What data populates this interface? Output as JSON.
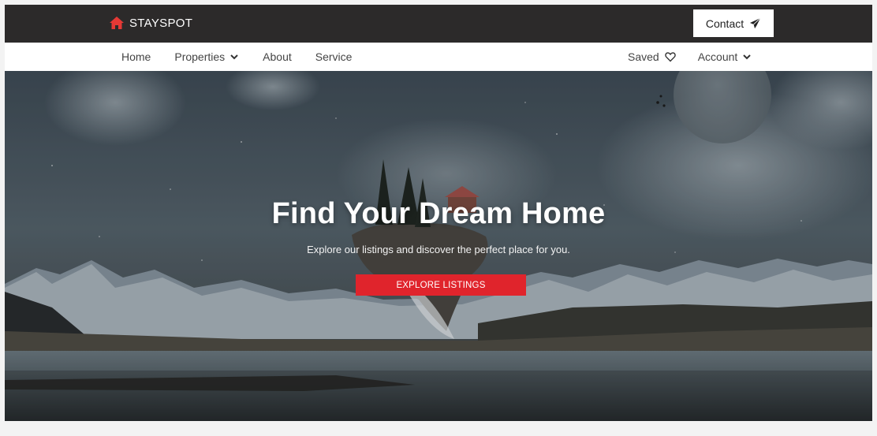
{
  "brand": {
    "name": "STAYSPOT",
    "icon": "home-icon",
    "icon_color": "#e53935"
  },
  "topbar": {
    "contact_label": "Contact",
    "contact_icon": "paper-plane-icon"
  },
  "nav": {
    "left": [
      {
        "label": "Home"
      },
      {
        "label": "Properties",
        "icon": "chevron-down-icon"
      },
      {
        "label": "About"
      },
      {
        "label": "Service"
      }
    ],
    "right": [
      {
        "label": "Saved",
        "icon": "heart-icon"
      },
      {
        "label": "Account",
        "icon": "chevron-down-icon"
      }
    ]
  },
  "hero": {
    "title": "Find Your Dream Home",
    "subtitle": "Explore our listings and discover the perfect place for you.",
    "cta_label": "EXPLORE LISTINGS",
    "cta_color": "#e0242c"
  },
  "colors": {
    "topbar": "#2c2a2a",
    "navbar": "#ffffff",
    "page": "#f3f3f3"
  }
}
